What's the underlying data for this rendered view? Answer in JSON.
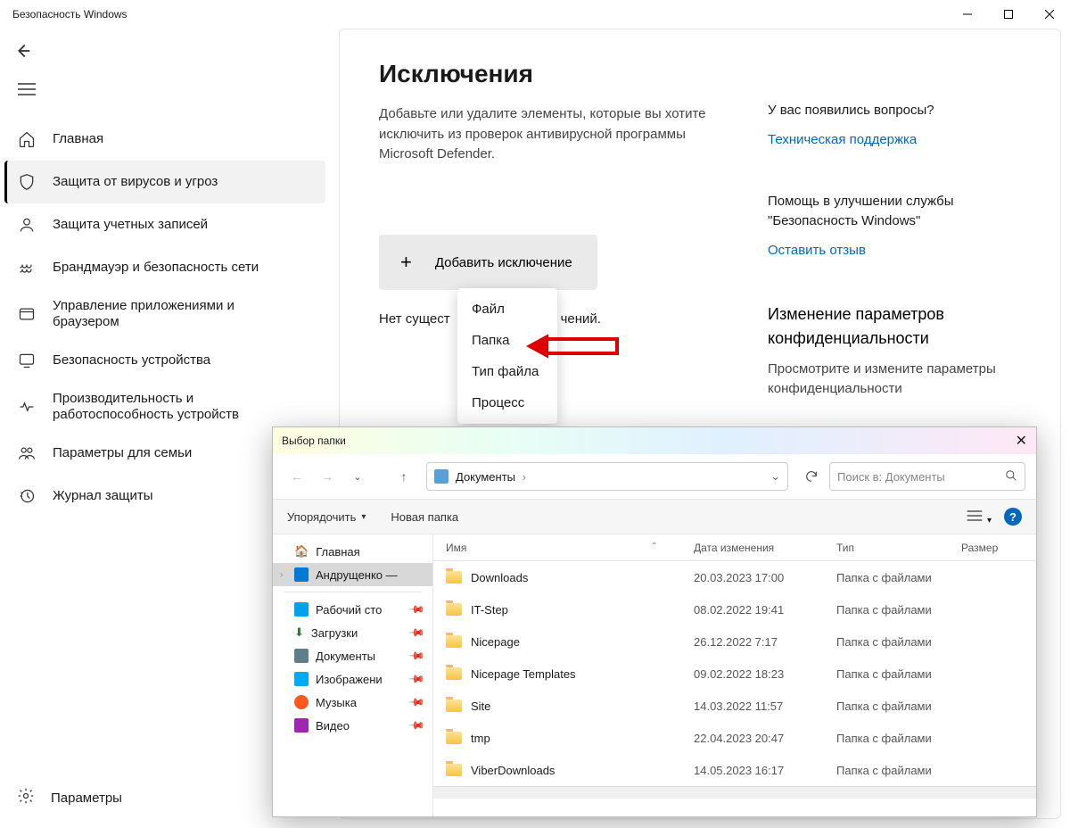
{
  "window": {
    "title": "Безопасность Windows"
  },
  "sidebar": {
    "items": [
      {
        "label": "Главная"
      },
      {
        "label": "Защита от вирусов и угроз"
      },
      {
        "label": "Защита учетных записей"
      },
      {
        "label": "Брандмауэр и безопасность сети"
      },
      {
        "label": "Управление приложениями и браузером"
      },
      {
        "label": "Безопасность устройства"
      },
      {
        "label": "Производительность и работоспособность устройств"
      },
      {
        "label": "Параметры для семьи"
      },
      {
        "label": "Журнал защиты"
      }
    ],
    "settings": "Параметры"
  },
  "main": {
    "title": "Исключения",
    "description": "Добавьте или удалите элементы, которые вы хотите исключить из проверок антивирусной программы Microsoft Defender.",
    "add_button": "Добавить исключение",
    "no_exclusions_prefix": "Нет сущест",
    "no_exclusions_suffix": "чений.",
    "dropdown": {
      "file": "Файл",
      "folder": "Папка",
      "filetype": "Тип файла",
      "process": "Процесс"
    }
  },
  "right": {
    "q_title": "У вас появились вопросы?",
    "q_link": "Техническая поддержка",
    "help_title": "Помощь в улучшении службы \"Безопасность Windows\"",
    "help_link": "Оставить отзыв",
    "priv_title": "Изменение параметров конфиденциальности",
    "priv_text": "Просмотрите и измените параметры конфиденциальности"
  },
  "dialog": {
    "title": "Выбор папки",
    "breadcrumb": "Документы",
    "search_placeholder": "Поиск в: Документы",
    "organize": "Упорядочить",
    "new_folder": "Новая папка",
    "side": {
      "home": "Главная",
      "user": "Андрущенко —",
      "desktop": "Рабочий сто",
      "downloads": "Загрузки",
      "documents": "Документы",
      "pictures": "Изображени",
      "music": "Музыка",
      "video": "Видео"
    },
    "columns": {
      "name": "Имя",
      "date": "Дата изменения",
      "type": "Тип",
      "size": "Размер"
    },
    "folder_type": "Папка с файлами",
    "files": [
      {
        "name": "Downloads",
        "date": "20.03.2023 17:00"
      },
      {
        "name": "IT-Step",
        "date": "08.02.2022 19:41"
      },
      {
        "name": "Nicepage",
        "date": "26.12.2022 7:17"
      },
      {
        "name": "Nicepage Templates",
        "date": "09.02.2022 18:23"
      },
      {
        "name": "Site",
        "date": "14.03.2022 11:57"
      },
      {
        "name": "tmp",
        "date": "22.04.2023 20:47"
      },
      {
        "name": "ViberDownloads",
        "date": "14.05.2023 16:17"
      }
    ]
  }
}
